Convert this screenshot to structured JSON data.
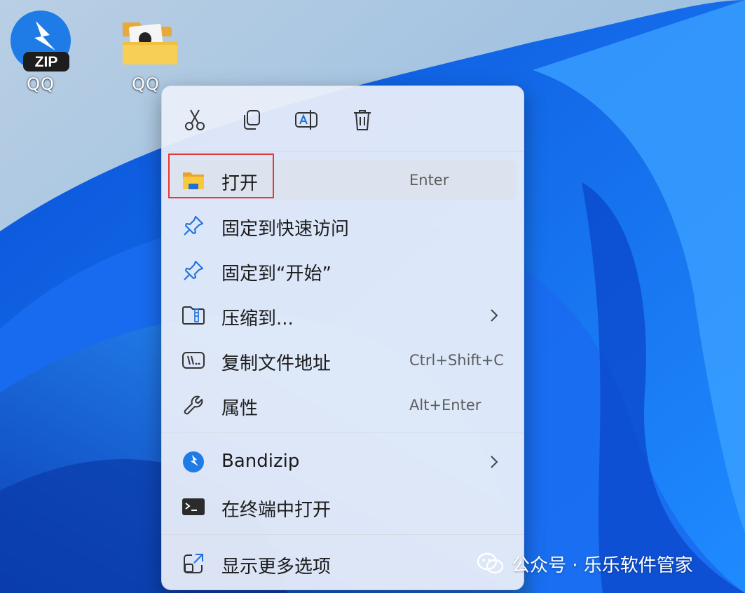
{
  "desktop": {
    "icons": [
      {
        "label": "QQ",
        "badge": "ZIP"
      },
      {
        "label": "QQ"
      }
    ]
  },
  "toolbar": {
    "cut": "cut-icon",
    "copy": "copy-icon",
    "rename": "rename-icon",
    "delete": "trash-icon"
  },
  "menu": {
    "items": [
      {
        "label": "打开",
        "shortcut": "Enter",
        "icon": "folder-open-icon"
      },
      {
        "label": "固定到快速访问",
        "icon": "pin-icon"
      },
      {
        "label": "固定到“开始”",
        "icon": "pin-icon"
      },
      {
        "label": "压缩到...",
        "icon": "zip-folder-icon"
      },
      {
        "label": "复制文件地址",
        "shortcut": "Ctrl+Shift+C",
        "icon": "copy-path-icon"
      },
      {
        "label": "属性",
        "shortcut": "Alt+Enter",
        "icon": "wrench-icon"
      },
      {
        "label": "Bandizip",
        "icon": "bandizip-icon"
      },
      {
        "label": "在终端中打开",
        "icon": "terminal-icon"
      },
      {
        "label": "显示更多选项",
        "icon": "more-options-icon"
      }
    ]
  },
  "watermark": {
    "text": "公众号 · 乐乐软件管家"
  },
  "colors": {
    "accent": "#1e6fd9",
    "highlight": "#e53935",
    "menu_bg": "#ecf0fa"
  }
}
